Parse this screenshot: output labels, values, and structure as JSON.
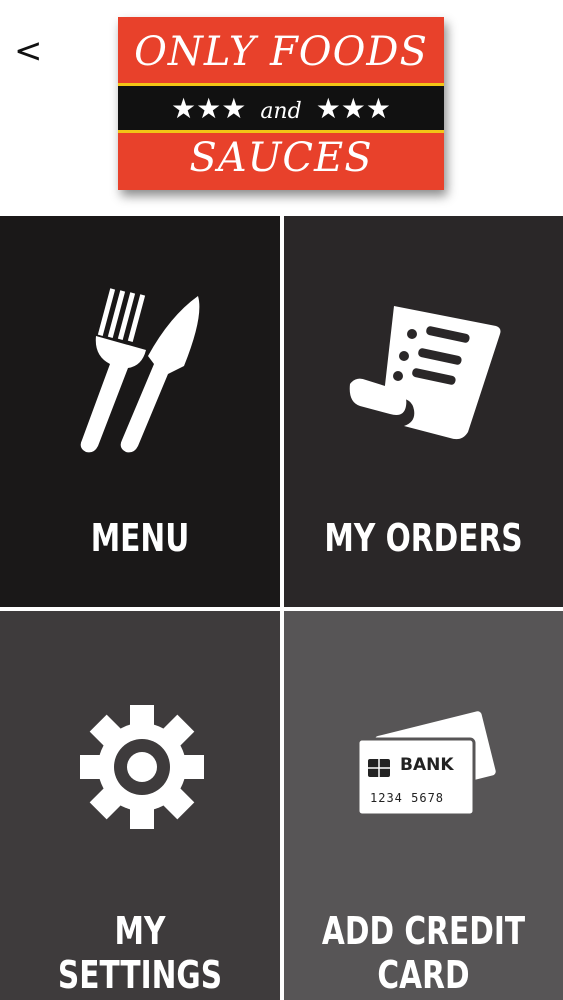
{
  "header": {
    "back_label": "<",
    "logo": {
      "line1": "ONLY FOODS",
      "and": "and",
      "line2": "SAUCES",
      "stars": "★★★"
    }
  },
  "tiles": [
    {
      "label": "MENU",
      "icon": "fork-knife-icon",
      "bg": "#1a1818"
    },
    {
      "label": "MY ORDERS",
      "icon": "receipt-icon",
      "bg": "#2a2728"
    },
    {
      "label": "MY SETTINGS",
      "icon": "gear-icon",
      "bg": "#3e3b3c"
    },
    {
      "label": "ADD CREDIT CARD",
      "icon": "credit-card-icon",
      "bg": "#575556",
      "card_text": {
        "bank": "BANK",
        "number": "1234 5678"
      }
    }
  ],
  "colors": {
    "logo_red": "#e8412b",
    "logo_gold": "#f2c516",
    "divider": "#ffffff"
  }
}
